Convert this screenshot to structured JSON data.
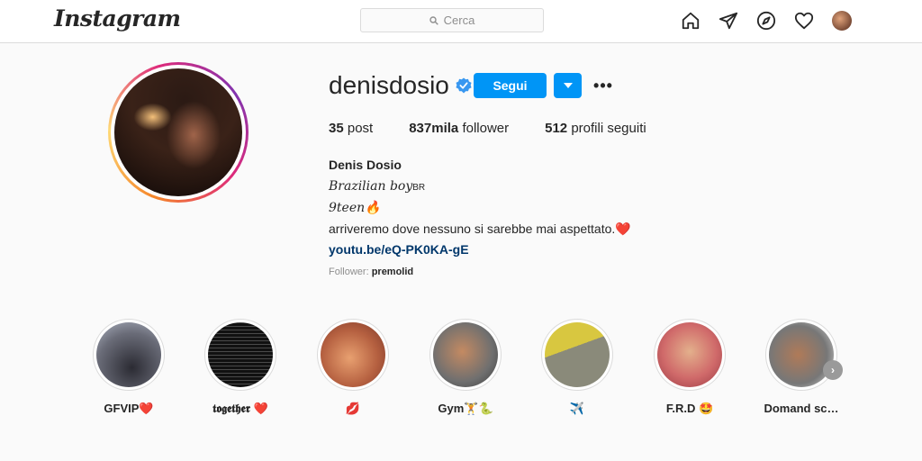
{
  "nav": {
    "logo": "Instagram",
    "search_placeholder": "Cerca",
    "icons": [
      "home-icon",
      "direct-icon",
      "explore-icon",
      "activity-icon",
      "profile-avatar"
    ]
  },
  "profile": {
    "username": "denisdosio",
    "verified": true,
    "follow_label": "Segui",
    "stats": {
      "posts_count": "35",
      "posts_label": "post",
      "followers_count": "837mila",
      "followers_label": "follower",
      "following_count": "512",
      "following_label": "profili seguiti"
    },
    "bio": {
      "full_name": "Denis Dosio",
      "line1": "Brazilian boy",
      "line1_flag": "BR",
      "line2": "9teen🔥",
      "line3": "arriveremo dove nessuno si sarebbe mai aspettato.❤️",
      "link": "youtu.be/eQ-PK0KA-gE"
    },
    "followed_by_label": "Follower:",
    "followed_by_user": "premolid"
  },
  "highlights": [
    {
      "label": "GFVIP❤️"
    },
    {
      "label": "𝖙𝖔𝖌𝖊𝖙𝖍𝖊𝖗 ❤️"
    },
    {
      "label": "💋"
    },
    {
      "label": "Gym🏋️🐍"
    },
    {
      "label": "✈️"
    },
    {
      "label": "F.R.D 🤩"
    },
    {
      "label": "Domand sc…"
    }
  ],
  "colors": {
    "accent": "#0095f6",
    "link": "#00376b",
    "verified": "#3897f0"
  }
}
